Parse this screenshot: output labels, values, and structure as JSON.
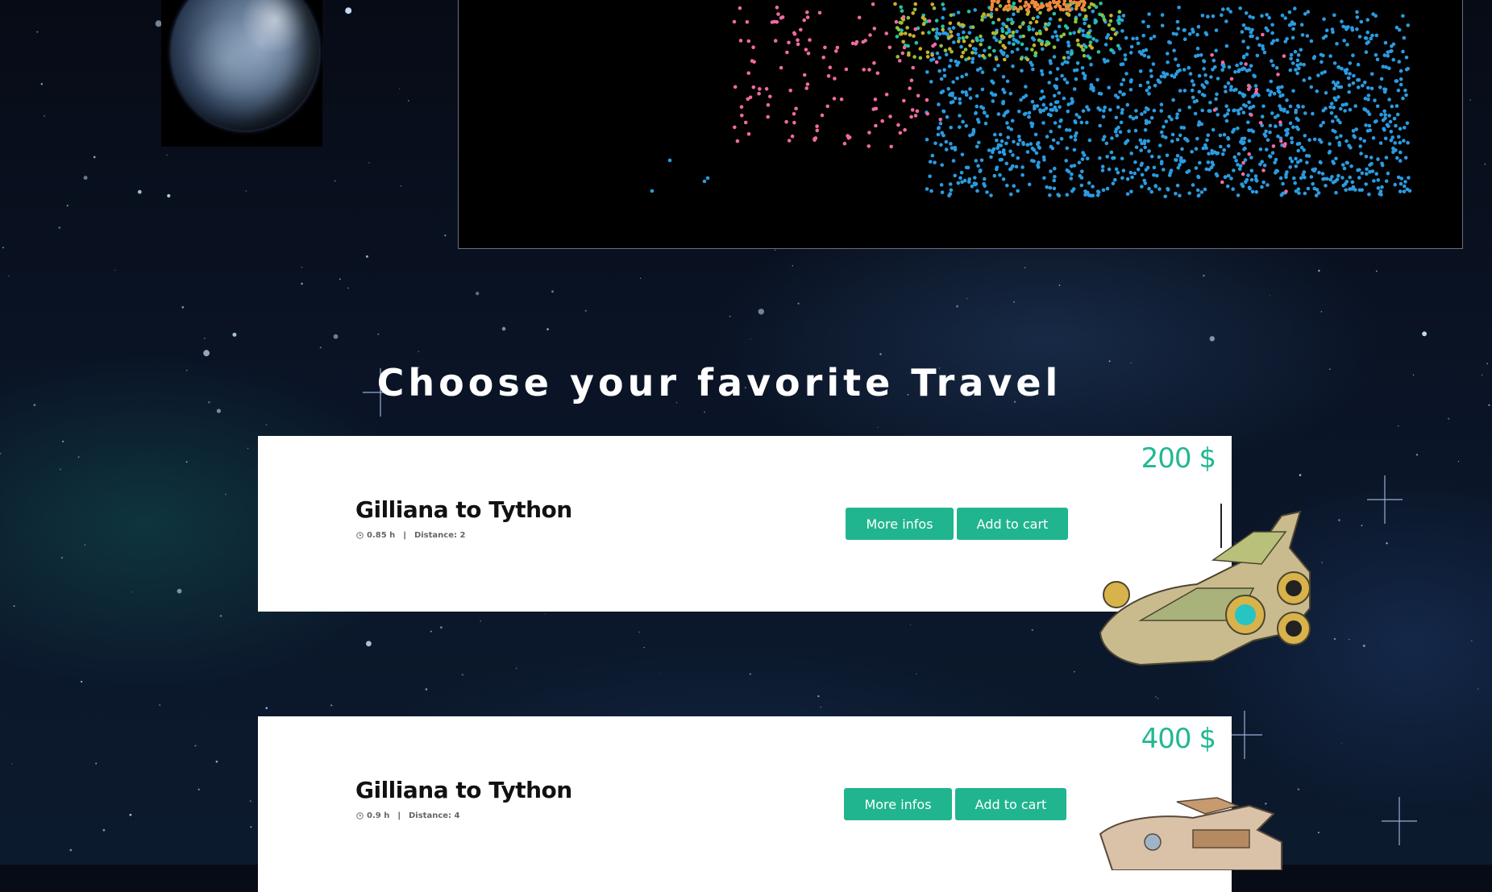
{
  "section": {
    "title": "Choose your favorite Travel"
  },
  "travels": [
    {
      "route": "Gilliana to Tython",
      "duration": "0.85 h",
      "distance": "Distance: 2",
      "price": "200 $",
      "more_label": "More infos",
      "cart_label": "Add to cart"
    },
    {
      "route": "Gilliana to Tython",
      "duration": "0.9 h",
      "distance": "Distance: 4",
      "price": "400 $",
      "more_label": "More infos",
      "cart_label": "Add to cart"
    }
  ],
  "colors": {
    "accent": "#20b58e",
    "price": "#22b892",
    "card_bg": "#ffffff"
  },
  "icons": {
    "clock": "clock-icon",
    "planet": "planet-image",
    "ship": "spaceship-image"
  }
}
